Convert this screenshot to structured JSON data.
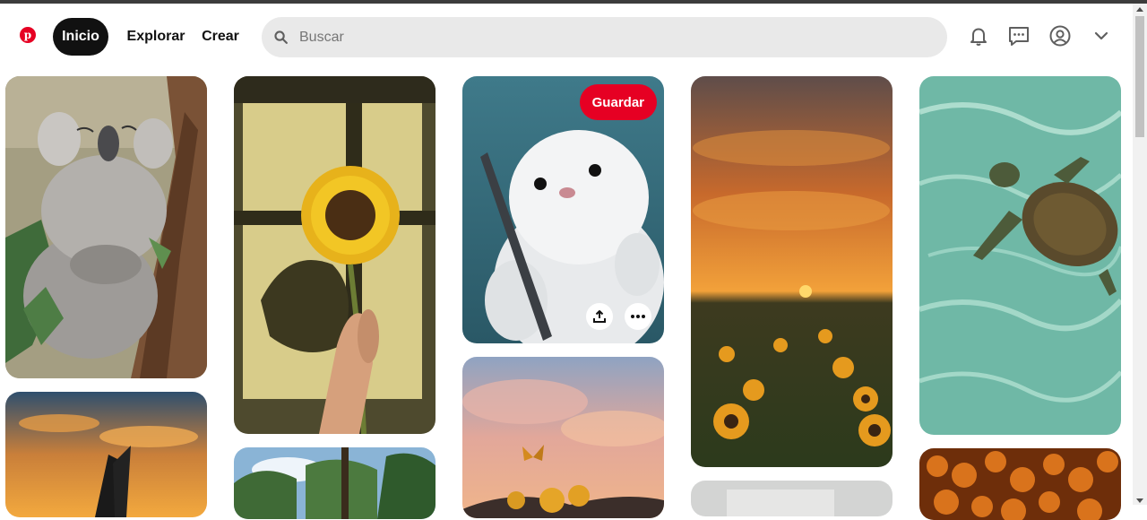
{
  "header": {
    "logo_letter": "p",
    "nav": {
      "home": "Inicio",
      "explore": "Explorar",
      "create": "Crear"
    },
    "search_placeholder": "Buscar"
  },
  "icons": {
    "search": "search-icon",
    "notifications": "bell-icon",
    "messages": "chat-icon",
    "profile": "user-circle-icon",
    "accounts": "chevron-down-icon",
    "share": "upload-icon",
    "more": "more-icon"
  },
  "hovered_pin": {
    "save_label": "Guardar"
  },
  "colors": {
    "brand": "#e60023",
    "nav_active_bg": "#111111",
    "search_bg": "#e9e9e9"
  },
  "pins": [
    {
      "subject": "koala-sleeping"
    },
    {
      "subject": "hand-holding-sunflower"
    },
    {
      "subject": "white-seal-pup"
    },
    {
      "subject": "sunflower-field-sunset"
    },
    {
      "subject": "sea-turtle-swimming"
    },
    {
      "subject": "butterfly-sunset-sky"
    },
    {
      "subject": "forest-trees"
    },
    {
      "subject": "pink-sky-butterflies-sunflowers"
    },
    {
      "subject": "white-image"
    },
    {
      "subject": "orange-flowers"
    }
  ]
}
